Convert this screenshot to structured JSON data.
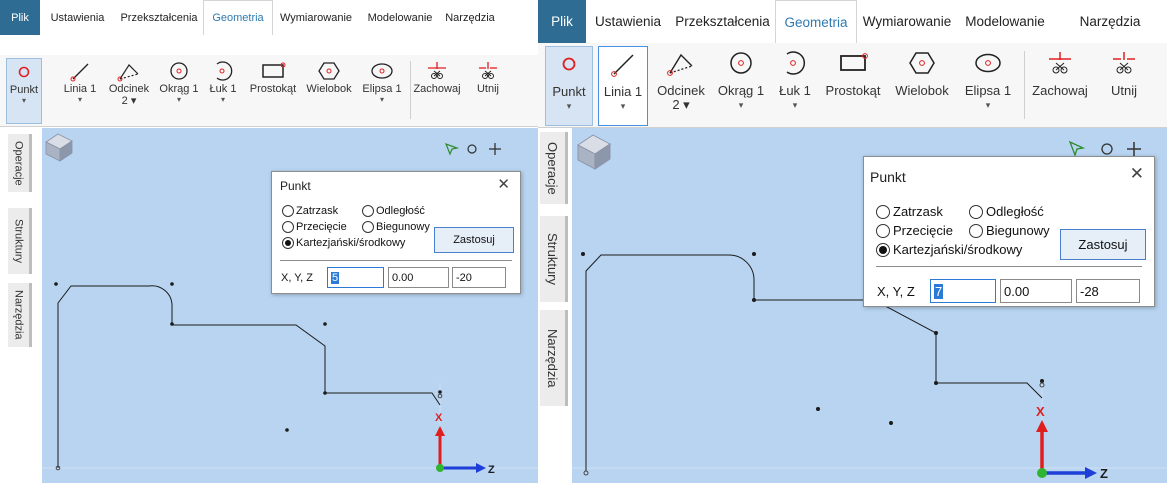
{
  "menu": {
    "tabs": [
      "Plik",
      "Ustawienia",
      "Przekształcenia",
      "Geometria",
      "Wymiarowanie",
      "Modelowanie",
      "Narzędzia"
    ]
  },
  "ribbon": {
    "tools": [
      {
        "label": "Punkt",
        "icon": "point-icon",
        "has_dropdown": true
      },
      {
        "label": "Linia 1",
        "icon": "line-icon",
        "has_dropdown": true
      },
      {
        "label": "Odcinek",
        "label2": "2",
        "icon": "segment-icon",
        "has_dropdown": true
      },
      {
        "label": "Okrąg 1",
        "icon": "circle-icon",
        "has_dropdown": true
      },
      {
        "label": "Łuk 1",
        "icon": "arc-icon",
        "has_dropdown": true
      },
      {
        "label": "Prostokąt",
        "icon": "rectangle-icon",
        "has_dropdown": false
      },
      {
        "label": "Wielobok",
        "icon": "polygon-icon",
        "has_dropdown": false
      },
      {
        "label": "Elipsa 1",
        "icon": "ellipse-icon",
        "has_dropdown": true
      },
      {
        "label": "Zachowaj",
        "icon": "trim-keep-icon",
        "has_dropdown": false
      },
      {
        "label": "Utnij",
        "icon": "trim-cut-icon",
        "has_dropdown": false
      }
    ]
  },
  "side_tabs": [
    "Operacje",
    "Struktury",
    "Narzędzia"
  ],
  "dialog": {
    "title": "Punkt",
    "close_icon": "close-icon",
    "options": [
      {
        "label": "Zatrzask",
        "selected": false
      },
      {
        "label": "Odległość",
        "selected": false
      },
      {
        "label": "Przecięcie",
        "selected": false
      },
      {
        "label": "Biegunowy",
        "selected": false
      },
      {
        "label": "Kartezjański/środkowy",
        "selected": true
      }
    ],
    "apply_label": "Zastosuj",
    "xyz_label": "X, Y, Z"
  },
  "left": {
    "x": "5",
    "y": "0.00",
    "z": "-20"
  },
  "right": {
    "x": "7",
    "y": "0.00",
    "z": "-28"
  },
  "axes": {
    "x_label": "X",
    "z_label": "Z",
    "x_color": "#e01e1e",
    "z_color": "#1e3ed8",
    "origin_color": "#2fb52f"
  },
  "colors": {
    "file_tab": "#2e6c93",
    "active_tab_text": "#2f7ab0",
    "canvas_bg": "#b8d4f1",
    "point_red": "#e02020"
  }
}
